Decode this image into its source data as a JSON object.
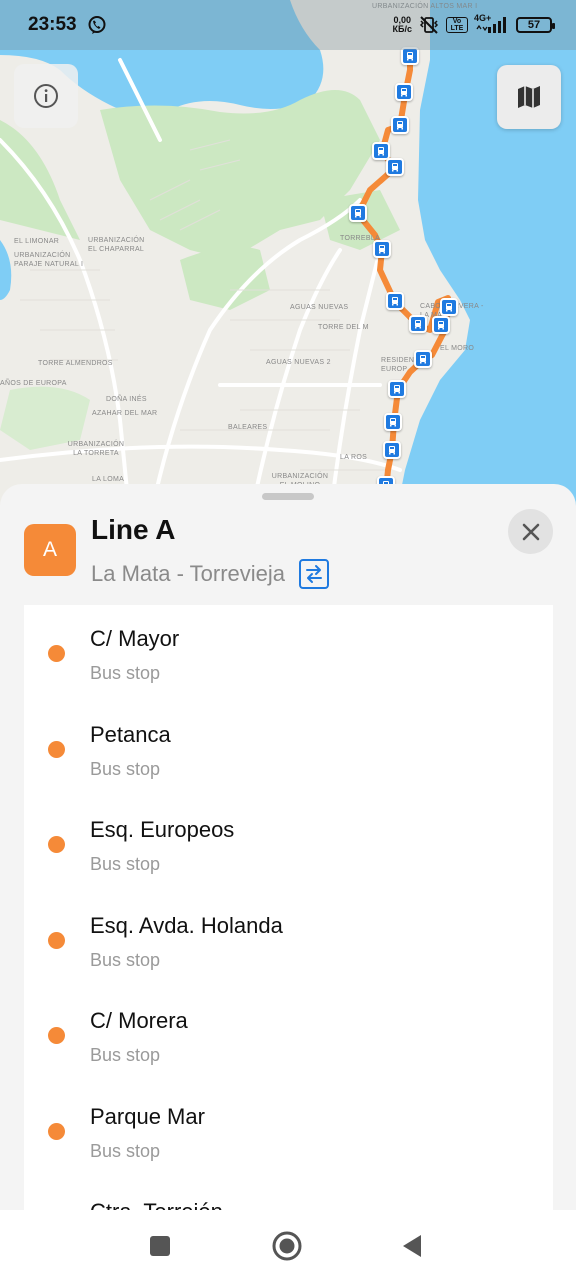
{
  "status_bar": {
    "time": "23:53",
    "net_speed_value": "0,00",
    "net_speed_unit": "КБ/с",
    "volte_label": "Vo LTE",
    "network_label": "4G+",
    "battery_level": "57",
    "icons": [
      "viber-icon",
      "vibrate-icon",
      "volte-icon",
      "signal-icon",
      "battery-icon"
    ]
  },
  "map": {
    "labels": [
      "URBANIZACIÓN ALTOS MAR I",
      "TORREBLA",
      "EL LIMONAR",
      "URBANIZACIÓN EL CHAPARRAL",
      "URBANIZACIÓN PARAJE NATURAL I",
      "AGUAS NUEVAS",
      "TORRE DEL M",
      "CABO CERVERA - LA MATA",
      "EL MORO",
      "AGUAS NUEVAS 2",
      "RESIDEN EUROP",
      "TORRE ALMENDROS",
      "AÑOS DE EUROPA",
      "DOÑA INÉS",
      "AZAHAR DEL MAR",
      "URBANIZACIÓN LA TORRETA",
      "BALEARES",
      "LA ROS",
      "URBANIZACIÓN EL MOLINO",
      "LA LOMA"
    ],
    "colors": {
      "water": "#7fcdf5",
      "land": "#eeede8",
      "green": "#cce8c2",
      "route": "#f58a38",
      "stop": "#1f7ae0"
    },
    "info_icon": "info-icon",
    "layers_icon": "map-icon",
    "stop_icon": "bus-icon"
  },
  "sheet": {
    "badge": "A",
    "title": "Line A",
    "subtitle": "La Mata - Torrevieja",
    "swap_icon": "swap-direction-icon",
    "close_icon": "close-icon",
    "stops": [
      {
        "name": "C/ Mayor",
        "type": "Bus stop"
      },
      {
        "name": "Petanca",
        "type": "Bus stop"
      },
      {
        "name": "Esq. Europeos",
        "type": "Bus stop"
      },
      {
        "name": "Esq. Avda. Holanda",
        "type": "Bus stop"
      },
      {
        "name": "C/ Morera",
        "type": "Bus stop"
      },
      {
        "name": "Parque Mar",
        "type": "Bus stop"
      },
      {
        "name": "Ctra. Torrejón",
        "type": ""
      }
    ],
    "accent": "#f58a38"
  },
  "nav_bar": {
    "recents_icon": "square-icon",
    "home_icon": "home-circle-icon",
    "back_icon": "back-triangle-icon"
  }
}
